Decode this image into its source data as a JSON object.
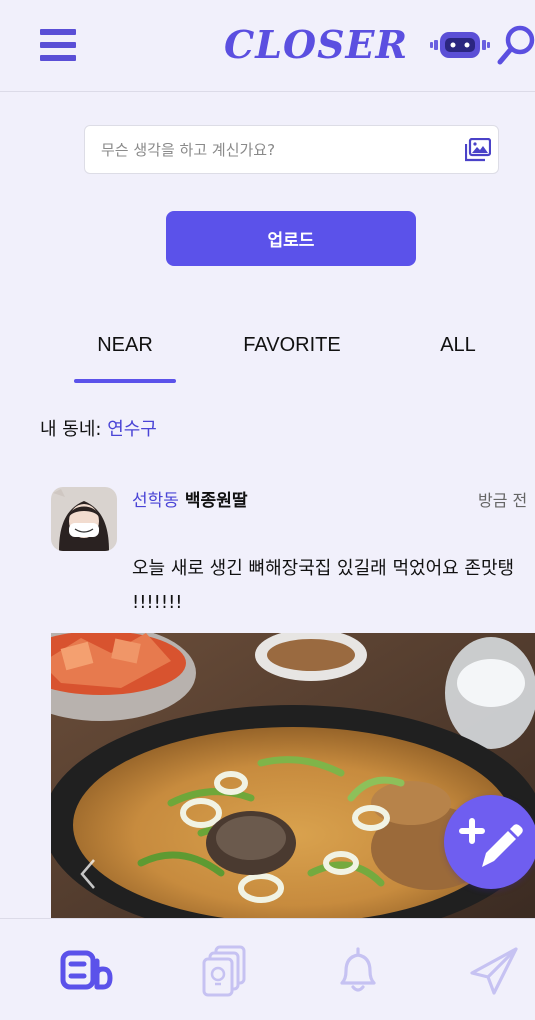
{
  "header": {
    "logo": "CLOSER",
    "icons": [
      "menu-icon",
      "robot-icon",
      "search-icon"
    ],
    "brand_color": "#5b52ea"
  },
  "composer": {
    "placeholder": "무슨 생각을 하고 계신가요?",
    "value": "",
    "upload_label": "업로드"
  },
  "tabs": [
    {
      "label": "NEAR",
      "active": true
    },
    {
      "label": "FAVORITE",
      "active": false
    },
    {
      "label": "ALL",
      "active": false
    }
  ],
  "neighborhood": {
    "label": "내 동네: ",
    "value": "연수구"
  },
  "post": {
    "location": "선학동",
    "username": "백종원딸",
    "time": "방금 전",
    "body": "오늘 새로 생긴 뼈해장국집 있길래 먹었어요 존맛탱 !!!!!!!"
  },
  "bottom_nav": [
    {
      "name": "feed",
      "icon": "feed-icon",
      "active": true
    },
    {
      "name": "cards",
      "icon": "cards-lightbulb-icon",
      "active": false
    },
    {
      "name": "notifications",
      "icon": "bell-icon",
      "active": false
    },
    {
      "name": "messages",
      "icon": "send-icon",
      "active": false
    }
  ],
  "colors": {
    "accent": "#5b52ea",
    "inactive_icon": "#c6c2f2",
    "background": "#f1f0fb"
  }
}
